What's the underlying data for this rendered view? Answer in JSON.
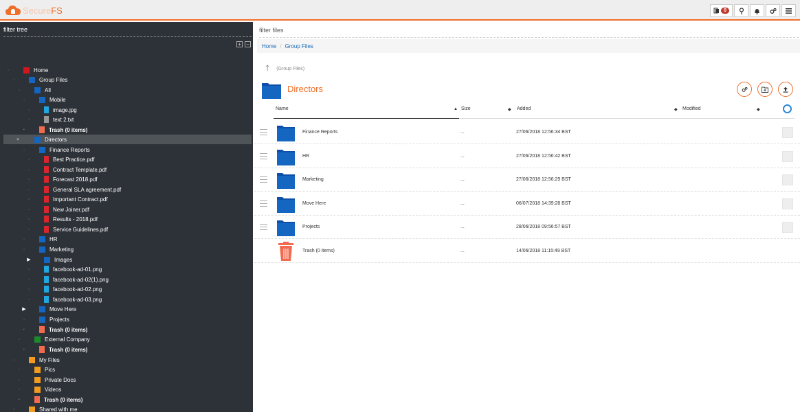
{
  "app": {
    "logo_part1": "Secure",
    "logo_part2": "FS",
    "notification_count": "0"
  },
  "topbar": {
    "icons": [
      "clipboard-icon",
      "pin-icon",
      "bell-icon",
      "settings-icon",
      "menu-icon"
    ]
  },
  "sidebar": {
    "filter_placeholder": "filter tree",
    "tree": [
      {
        "label": "Home",
        "type": "home"
      },
      {
        "label": "Group Files",
        "type": "folder"
      },
      {
        "label": "All",
        "type": "folder"
      },
      {
        "label": "Mobile",
        "type": "folder"
      },
      {
        "label": "image.jpg",
        "type": "img"
      },
      {
        "label": "text 2.txt",
        "type": "txt"
      },
      {
        "label": "Trash (0 items)",
        "type": "trash"
      },
      {
        "label": "Directors",
        "type": "folder"
      },
      {
        "label": "Finance Reports",
        "type": "folder"
      },
      {
        "label": "Best Practice.pdf",
        "type": "pdf"
      },
      {
        "label": "Contract Template.pdf",
        "type": "pdf"
      },
      {
        "label": "Forecast 2018.pdf",
        "type": "pdf"
      },
      {
        "label": "General SLA agreement.pdf",
        "type": "pdf"
      },
      {
        "label": "Important Contract.pdf",
        "type": "pdf"
      },
      {
        "label": "New Joiner.pdf",
        "type": "pdf"
      },
      {
        "label": "Results - 2018.pdf",
        "type": "pdf"
      },
      {
        "label": "Service Guidelines.pdf",
        "type": "pdf"
      },
      {
        "label": "HR",
        "type": "folder"
      },
      {
        "label": "Marketing",
        "type": "folder"
      },
      {
        "label": "Images",
        "type": "folder"
      },
      {
        "label": "facebook-ad-01.png",
        "type": "img"
      },
      {
        "label": "facebook-ad-02(1).png",
        "type": "img"
      },
      {
        "label": "facebook-ad-02.png",
        "type": "img"
      },
      {
        "label": "facebook-ad-03.png",
        "type": "img"
      },
      {
        "label": "Move Here",
        "type": "folder"
      },
      {
        "label": "Projects",
        "type": "folder"
      },
      {
        "label": "Trash (0 items)",
        "type": "trash"
      },
      {
        "label": "External Company",
        "type": "green"
      },
      {
        "label": "Trash (0 items)",
        "type": "trash"
      },
      {
        "label": "My Files",
        "type": "orange"
      },
      {
        "label": "Pics",
        "type": "orange"
      },
      {
        "label": "Private Docs",
        "type": "orange"
      },
      {
        "label": "Videos",
        "type": "orange"
      },
      {
        "label": "Trash (0 items)",
        "type": "trash"
      },
      {
        "label": "Shared with me",
        "type": "orange"
      }
    ]
  },
  "main": {
    "filter_placeholder": "filter files",
    "breadcrumb": [
      "Home",
      "Group Files"
    ],
    "parent_label": "(Group Files)",
    "title": "Directors",
    "columns": {
      "name": "Name",
      "size": "Size",
      "added": "Added",
      "modified": "Modified"
    },
    "rows": [
      {
        "name": "Finance Reports",
        "size": "...",
        "added": "27/06/2018 12:56:34 BST",
        "type": "folder"
      },
      {
        "name": "HR",
        "size": "...",
        "added": "27/06/2018 12:56:42 BST",
        "type": "folder"
      },
      {
        "name": "Marketing",
        "size": "...",
        "added": "27/06/2018 12:56:29 BST",
        "type": "folder"
      },
      {
        "name": "Move Here",
        "size": "...",
        "added": "06/07/2018 14:39:28 BST",
        "type": "folder"
      },
      {
        "name": "Projects",
        "size": "...",
        "added": "28/06/2018 09:56:57 BST",
        "type": "folder"
      },
      {
        "name": "Trash (0 items)",
        "size": "...",
        "added": "14/06/2018 11:15:49 BST",
        "type": "trash"
      }
    ]
  }
}
